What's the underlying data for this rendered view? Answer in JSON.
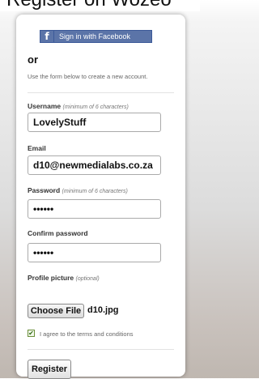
{
  "header": {
    "title": "Register on Wozeo"
  },
  "facebook": {
    "label": "Sign in with Facebook",
    "icon": "facebook-icon",
    "color": "#5b74a8"
  },
  "form": {
    "or_text": "or",
    "intro": "Use the form below to create a new account.",
    "username": {
      "label": "Username",
      "hint": "(minimum of 6 characters)",
      "value": "LovelyStuff"
    },
    "email": {
      "label": "Email",
      "value": "d10@newmedialabs.co.za"
    },
    "password": {
      "label": "Password",
      "hint": "(minimum of 6 characters)",
      "value": "••••••"
    },
    "confirm": {
      "label": "Confirm password",
      "value": "••••••"
    },
    "picture": {
      "label": "Profile picture",
      "hint": "(optional)",
      "button": "Choose File",
      "filename": "d10.jpg"
    },
    "terms": {
      "label": "I agree to the terms and conditions",
      "checked": true
    },
    "submit": "Register"
  }
}
